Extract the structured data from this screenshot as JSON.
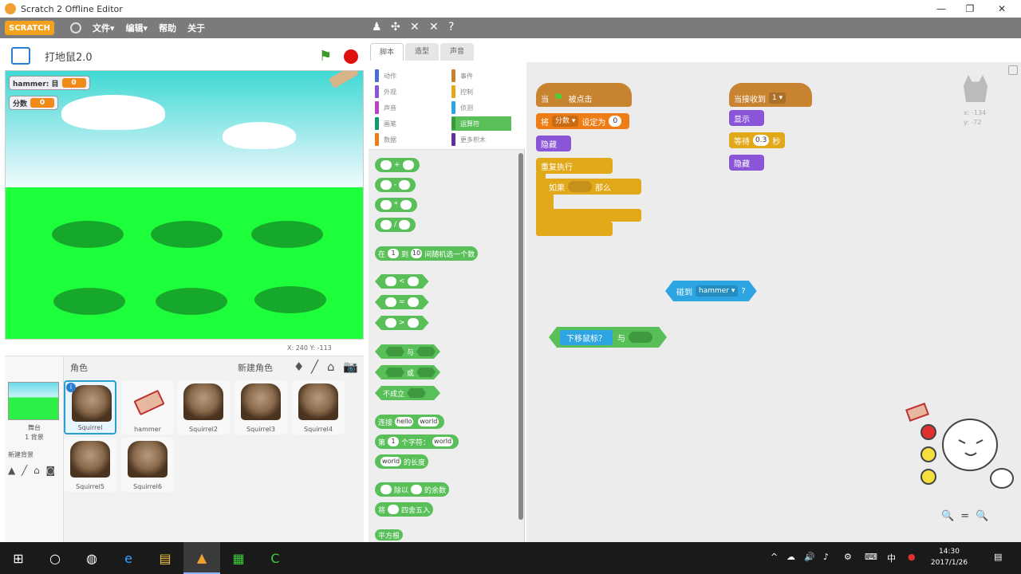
{
  "window": {
    "title": "Scratch 2 Offline Editor",
    "controls": [
      "—",
      "❐",
      "✕"
    ]
  },
  "menubar": {
    "logo": "SCRATCH",
    "menus": [
      "文件▾",
      "编辑▾",
      "帮助",
      "关于"
    ],
    "tools": [
      "♟",
      "✣",
      "✕",
      "✕",
      "?"
    ]
  },
  "stage": {
    "project_title": "打地鼠2.0",
    "monitors": [
      {
        "label": "hammer: 目",
        "value": "0"
      },
      {
        "label": "分数",
        "value": "0"
      }
    ],
    "coords": "X: 240  Y: -113"
  },
  "sprites_panel": {
    "stage_label": "舞台",
    "stage_sub": "1 背景",
    "new_backdrop": "新建背景",
    "title": "角色",
    "new_sprite": "新建角色",
    "new_sprite_tools": [
      "♦",
      "╱",
      "⌂",
      "📷"
    ],
    "backdrop_tools": "▲ ╱ ⌂ ◙",
    "sprites": [
      {
        "name": "Squirrel",
        "type": "squirrel",
        "selected": true
      },
      {
        "name": "hammer",
        "type": "hammer",
        "selected": false
      },
      {
        "name": "Squirrel2",
        "type": "squirrel",
        "selected": false
      },
      {
        "name": "Squirrel3",
        "type": "squirrel",
        "selected": false
      },
      {
        "name": "Squirrel4",
        "type": "squirrel",
        "selected": false
      },
      {
        "name": "Squirrel5",
        "type": "squirrel",
        "selected": false
      },
      {
        "name": "Squirrel6",
        "type": "squirrel",
        "selected": false
      }
    ]
  },
  "tabs": [
    "脚本",
    "造型",
    "声音"
  ],
  "categories": [
    {
      "label": "动作",
      "color": "#4a6cd4"
    },
    {
      "label": "外观",
      "color": "#8a55d7"
    },
    {
      "label": "声音",
      "color": "#bb42c3"
    },
    {
      "label": "画笔",
      "color": "#0e9a6c"
    },
    {
      "label": "数据",
      "color": "#ee7d16"
    },
    {
      "label": "事件",
      "color": "#c88330"
    },
    {
      "label": "控制",
      "color": "#e1a91a"
    },
    {
      "label": "侦测",
      "color": "#2ca5e2"
    },
    {
      "label": "运算符",
      "color": "#59c059"
    },
    {
      "label": "更多积木",
      "color": "#632d99"
    }
  ],
  "palette_blocks": {
    "ops": [
      "+",
      "-",
      "*",
      "/"
    ],
    "random": {
      "pre": "在",
      "from": "1",
      "mid": "到",
      "to": "10",
      "post": "间随机选一个数"
    },
    "compare": [
      "<",
      "=",
      ">"
    ],
    "logic": [
      "与",
      "或",
      "不成立"
    ],
    "join": {
      "pre": "连接",
      "a": "hello",
      "b": "world"
    },
    "letter": {
      "pre": "第",
      "n": "1",
      "mid": "个字符：",
      "s": "world"
    },
    "length": {
      "s": "world",
      "post": "的长度"
    },
    "mod": {
      "mid": "除以",
      "post": "的余数"
    },
    "round": {
      "pre": "将",
      "post": "四舍五入"
    },
    "last": "平方根"
  },
  "scripts": {
    "when_flag": {
      "pre": "当",
      "post": "被点击"
    },
    "set_var": {
      "pre": "将",
      "var": "分数 ▾",
      "mid": "设定为",
      "val": "0"
    },
    "hide1": "隐藏",
    "forever": "重复执行",
    "if_then": {
      "pre": "如果",
      "post": "那么"
    },
    "when_receive": {
      "pre": "当接收到",
      "msg": "1 ▾"
    },
    "show": "显示",
    "wait": {
      "pre": "等待",
      "val": "0.3",
      "post": "秒"
    },
    "hide2": "隐藏",
    "touching": {
      "pre": "碰到",
      "target": "hammer ▾",
      "post": "?"
    },
    "mouse_down": {
      "pre": "下移鼠标？",
      "post": "与"
    },
    "sprite_xy": [
      "x: -134",
      "y: -72"
    ],
    "zoom": [
      "🔍",
      "=",
      "🔍"
    ]
  },
  "taskbar": {
    "items": [
      "⊞",
      "○",
      "◍",
      "e",
      "▤",
      "▲",
      "▦",
      "C"
    ],
    "tray": [
      "^",
      "☁",
      "🔊",
      "♪",
      "⚙",
      "⌨",
      "中",
      "●"
    ],
    "time": "14:30",
    "date": "2017/1/26",
    "notify": "▤"
  }
}
